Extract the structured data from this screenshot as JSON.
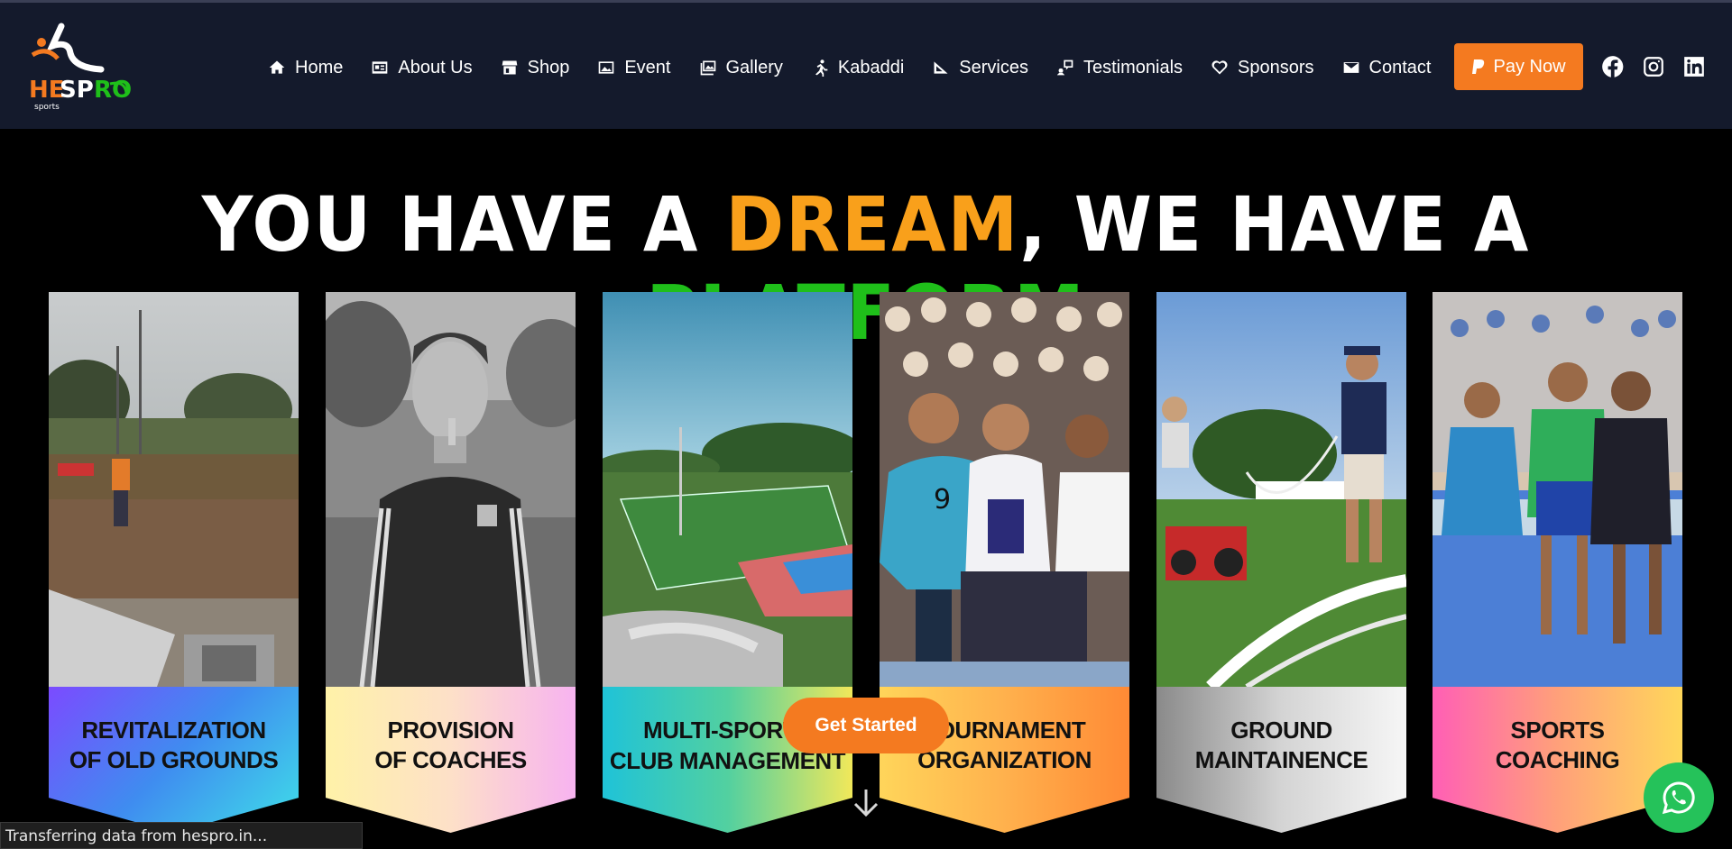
{
  "header": {
    "logo_alt": "HESPRO sports",
    "nav": [
      {
        "label": "Home",
        "icon": "home-icon"
      },
      {
        "label": "About Us",
        "icon": "id-card-icon"
      },
      {
        "label": "Shop",
        "icon": "store-icon"
      },
      {
        "label": "Event",
        "icon": "images-icon"
      },
      {
        "label": "Gallery",
        "icon": "gallery-icon"
      },
      {
        "label": "Kabaddi",
        "icon": "running-icon"
      },
      {
        "label": "Services",
        "icon": "slide-icon"
      },
      {
        "label": "Testimonials",
        "icon": "comment-user-icon"
      },
      {
        "label": "Sponsors",
        "icon": "heart-icon"
      },
      {
        "label": "Contact",
        "icon": "envelope-icon"
      }
    ],
    "pay_label": "Pay Now",
    "social": [
      "facebook-icon",
      "instagram-icon",
      "linkedin-icon"
    ]
  },
  "hero": {
    "part1": "YOU HAVE A ",
    "part2": "DREAM",
    "part3": ", WE HAVE A ",
    "part4": "PLATFORM"
  },
  "cards": [
    {
      "line1": "REVITALIZATION",
      "line2": "OF OLD GROUNDS"
    },
    {
      "line1": "PROVISION",
      "line2": "OF COACHES"
    },
    {
      "line1": "MULTI-SPORTS",
      "line2": "CLUB MANAGEMENT"
    },
    {
      "line1": "TOURNAMENT",
      "line2": "ORGANIZATION"
    },
    {
      "line1": "GROUND",
      "line2": "MAINTAINENCE"
    },
    {
      "line1": "SPORTS",
      "line2": "COACHING"
    }
  ],
  "get_started": "Get Started",
  "status_text": "Transferring data from hespro.in...",
  "colors": {
    "accent": "#f47a20",
    "header_bg": "#141a2c",
    "dream": "#f9a01b",
    "platform": "#1fbf1a"
  }
}
